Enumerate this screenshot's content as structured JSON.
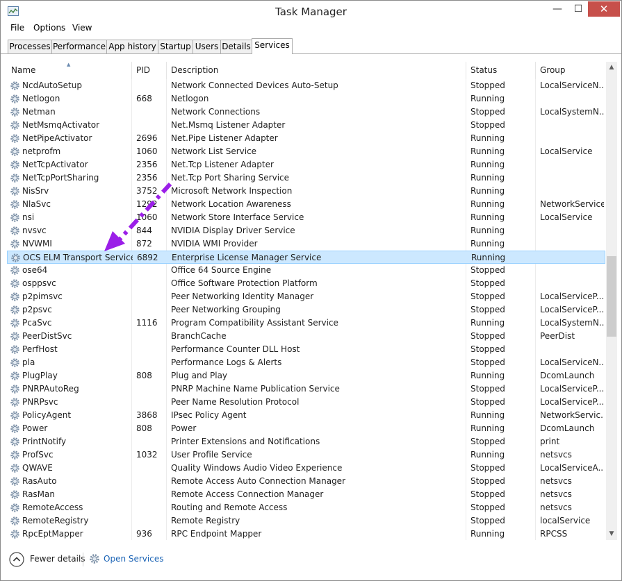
{
  "window": {
    "title": "Task Manager",
    "controls": {
      "minimize": "—",
      "maximize": "☐",
      "close": "✕"
    }
  },
  "menu": [
    "File",
    "Options",
    "View"
  ],
  "tabs": [
    {
      "label": "Processes",
      "active": false
    },
    {
      "label": "Performance",
      "active": false
    },
    {
      "label": "App history",
      "active": false
    },
    {
      "label": "Startup",
      "active": false
    },
    {
      "label": "Users",
      "active": false
    },
    {
      "label": "Details",
      "active": false
    },
    {
      "label": "Services",
      "active": true
    }
  ],
  "columns": {
    "name": "Name",
    "pid": "PID",
    "description": "Description",
    "status": "Status",
    "group": "Group"
  },
  "sort_indicator": "▲",
  "services": [
    {
      "name": "NcdAutoSetup",
      "pid": "",
      "description": "Network Connected Devices Auto-Setup",
      "status": "Stopped",
      "group": "LocalServiceN..."
    },
    {
      "name": "Netlogon",
      "pid": "668",
      "description": "Netlogon",
      "status": "Running",
      "group": ""
    },
    {
      "name": "Netman",
      "pid": "",
      "description": "Network Connections",
      "status": "Stopped",
      "group": "LocalSystemN..."
    },
    {
      "name": "NetMsmqActivator",
      "pid": "",
      "description": "Net.Msmq Listener Adapter",
      "status": "Stopped",
      "group": ""
    },
    {
      "name": "NetPipeActivator",
      "pid": "2696",
      "description": "Net.Pipe Listener Adapter",
      "status": "Running",
      "group": ""
    },
    {
      "name": "netprofm",
      "pid": "1060",
      "description": "Network List Service",
      "status": "Running",
      "group": "LocalService"
    },
    {
      "name": "NetTcpActivator",
      "pid": "2356",
      "description": "Net.Tcp Listener Adapter",
      "status": "Running",
      "group": ""
    },
    {
      "name": "NetTcpPortSharing",
      "pid": "2356",
      "description": "Net.Tcp Port Sharing Service",
      "status": "Running",
      "group": ""
    },
    {
      "name": "NisSrv",
      "pid": "3752",
      "description": "Microsoft Network Inspection",
      "status": "Running",
      "group": ""
    },
    {
      "name": "NlaSvc",
      "pid": "1292",
      "description": "Network Location Awareness",
      "status": "Running",
      "group": "NetworkService"
    },
    {
      "name": "nsi",
      "pid": "1060",
      "description": "Network Store Interface Service",
      "status": "Running",
      "group": "LocalService"
    },
    {
      "name": "nvsvc",
      "pid": "844",
      "description": "NVIDIA Display Driver Service",
      "status": "Running",
      "group": ""
    },
    {
      "name": "NVWMI",
      "pid": "872",
      "description": "NVIDIA WMI Provider",
      "status": "Running",
      "group": ""
    },
    {
      "name": "OCS ELM Transport Service",
      "pid": "6892",
      "description": "Enterprise License Manager Service",
      "status": "Running",
      "group": "",
      "selected": true
    },
    {
      "name": "ose64",
      "pid": "",
      "description": "Office 64 Source Engine",
      "status": "Stopped",
      "group": ""
    },
    {
      "name": "osppsvc",
      "pid": "",
      "description": "Office Software Protection Platform",
      "status": "Stopped",
      "group": ""
    },
    {
      "name": "p2pimsvc",
      "pid": "",
      "description": "Peer Networking Identity Manager",
      "status": "Stopped",
      "group": "LocalServiceP..."
    },
    {
      "name": "p2psvc",
      "pid": "",
      "description": "Peer Networking Grouping",
      "status": "Stopped",
      "group": "LocalServiceP..."
    },
    {
      "name": "PcaSvc",
      "pid": "1116",
      "description": "Program Compatibility Assistant Service",
      "status": "Running",
      "group": "LocalSystemN..."
    },
    {
      "name": "PeerDistSvc",
      "pid": "",
      "description": "BranchCache",
      "status": "Stopped",
      "group": "PeerDist"
    },
    {
      "name": "PerfHost",
      "pid": "",
      "description": "Performance Counter DLL Host",
      "status": "Stopped",
      "group": ""
    },
    {
      "name": "pla",
      "pid": "",
      "description": "Performance Logs & Alerts",
      "status": "Stopped",
      "group": "LocalServiceN..."
    },
    {
      "name": "PlugPlay",
      "pid": "808",
      "description": "Plug and Play",
      "status": "Running",
      "group": "DcomLaunch"
    },
    {
      "name": "PNRPAutoReg",
      "pid": "",
      "description": "PNRP Machine Name Publication Service",
      "status": "Stopped",
      "group": "LocalServiceP..."
    },
    {
      "name": "PNRPsvc",
      "pid": "",
      "description": "Peer Name Resolution Protocol",
      "status": "Stopped",
      "group": "LocalServiceP..."
    },
    {
      "name": "PolicyAgent",
      "pid": "3868",
      "description": "IPsec Policy Agent",
      "status": "Running",
      "group": "NetworkServic..."
    },
    {
      "name": "Power",
      "pid": "808",
      "description": "Power",
      "status": "Running",
      "group": "DcomLaunch"
    },
    {
      "name": "PrintNotify",
      "pid": "",
      "description": "Printer Extensions and Notifications",
      "status": "Stopped",
      "group": "print"
    },
    {
      "name": "ProfSvc",
      "pid": "1032",
      "description": "User Profile Service",
      "status": "Running",
      "group": "netsvcs"
    },
    {
      "name": "QWAVE",
      "pid": "",
      "description": "Quality Windows Audio Video Experience",
      "status": "Stopped",
      "group": "LocalServiceA..."
    },
    {
      "name": "RasAuto",
      "pid": "",
      "description": "Remote Access Auto Connection Manager",
      "status": "Stopped",
      "group": "netsvcs"
    },
    {
      "name": "RasMan",
      "pid": "",
      "description": "Remote Access Connection Manager",
      "status": "Stopped",
      "group": "netsvcs"
    },
    {
      "name": "RemoteAccess",
      "pid": "",
      "description": "Routing and Remote Access",
      "status": "Stopped",
      "group": "netsvcs"
    },
    {
      "name": "RemoteRegistry",
      "pid": "",
      "description": "Remote Registry",
      "status": "Stopped",
      "group": "localService"
    },
    {
      "name": "RpcEptMapper",
      "pid": "936",
      "description": "RPC Endpoint Mapper",
      "status": "Running",
      "group": "RPCSS"
    }
  ],
  "footer": {
    "fewer_details": "Fewer details",
    "open_services": "Open Services"
  },
  "colors": {
    "selection_bg": "#cce8ff",
    "selection_border": "#99d1ff",
    "link": "#1a63b5",
    "close_button": "#c7504b",
    "annotation_arrow": "#9b1fe8"
  },
  "annotation": {
    "icon": "dashed-arrow-icon",
    "points_to": "OCS ELM Transport Service"
  }
}
